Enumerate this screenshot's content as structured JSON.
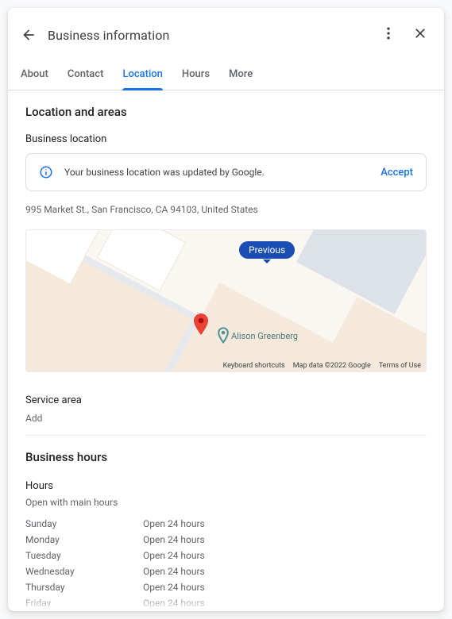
{
  "header": {
    "title": "Business information"
  },
  "tabs": {
    "about": "About",
    "contact": "Contact",
    "location": "Location",
    "hours": "Hours",
    "more": "More"
  },
  "location": {
    "section_title": "Location and areas",
    "business_location_label": "Business location",
    "banner_text": "Your business location was updated by Google.",
    "banner_action": "Accept",
    "address": "995 Market St., San Francisco, CA 94103, United States",
    "map": {
      "previous_label": "Previous",
      "poi_name": "Alison Greenberg",
      "footer_shortcuts": "Keyboard shortcuts",
      "footer_mapdata": "Map data ©2022 Google",
      "footer_terms": "Terms of Use"
    },
    "service_area_label": "Service area",
    "add_label": "Add"
  },
  "hours": {
    "section_title": "Business hours",
    "sub_label": "Hours",
    "status": "Open with main hours",
    "days": [
      {
        "day": "Sunday",
        "value": "Open 24 hours"
      },
      {
        "day": "Monday",
        "value": "Open 24 hours"
      },
      {
        "day": "Tuesday",
        "value": "Open 24 hours"
      },
      {
        "day": "Wednesday",
        "value": "Open 24 hours"
      },
      {
        "day": "Thursday",
        "value": "Open 24 hours"
      },
      {
        "day": "Friday",
        "value": "Open 24 hours"
      }
    ]
  }
}
